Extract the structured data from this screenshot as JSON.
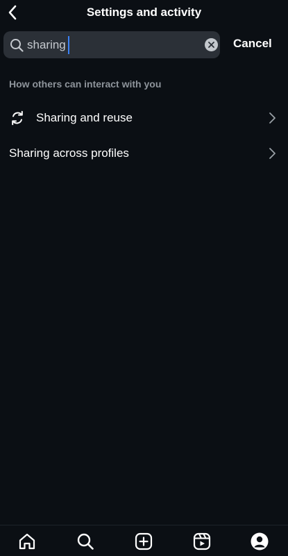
{
  "header": {
    "title": "Settings and activity",
    "back_icon": "chevron-left-icon"
  },
  "search": {
    "value": "sharing",
    "cancel_label": "Cancel",
    "search_icon": "search-icon",
    "clear_icon": "clear-icon"
  },
  "results": {
    "section_title": "How others can interact with you",
    "items": [
      {
        "label": "Sharing and reuse",
        "icon": "sharing-reuse-icon"
      },
      {
        "label": "Sharing across profiles"
      }
    ]
  },
  "tabbar": {
    "tabs": [
      {
        "icon": "home-icon"
      },
      {
        "icon": "search-icon"
      },
      {
        "icon": "create-post-icon"
      },
      {
        "icon": "reels-icon"
      },
      {
        "icon": "profile-icon"
      }
    ]
  },
  "colors": {
    "background": "#0b0f14",
    "search_field": "#2b3037",
    "caret": "#3b82f6",
    "section_text": "#8e949b"
  }
}
